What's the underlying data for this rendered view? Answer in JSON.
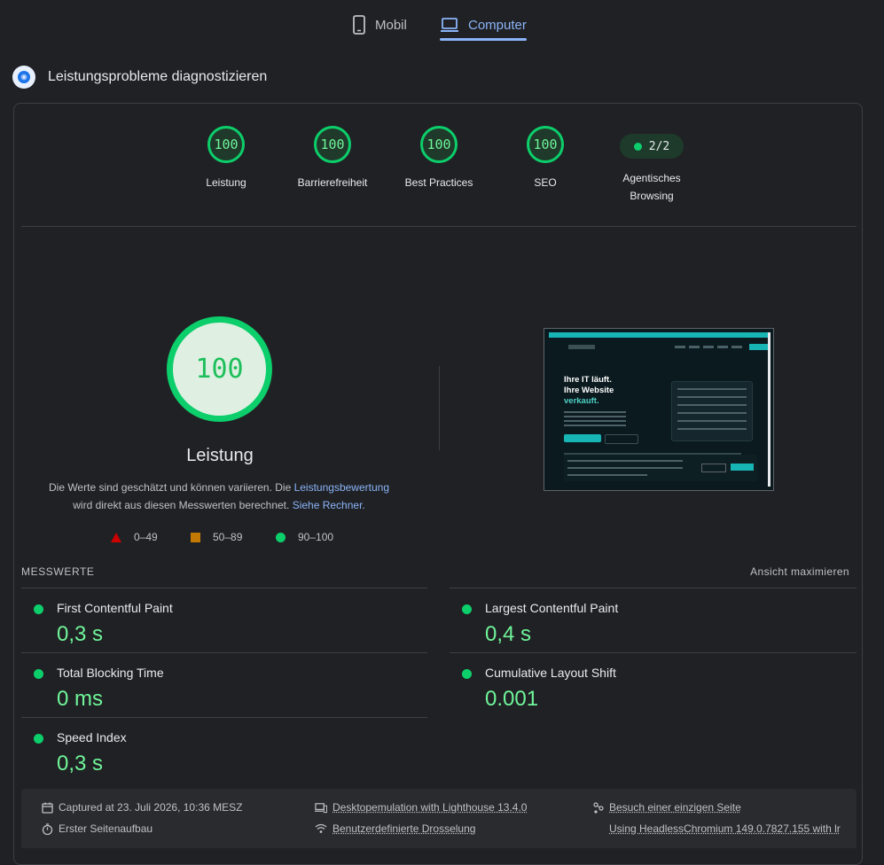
{
  "tabs": {
    "mobile": "Mobil",
    "desktop": "Computer"
  },
  "heading": "Leistungsprobleme diagnostizieren",
  "scores": [
    {
      "value": "100",
      "label": "Leistung"
    },
    {
      "value": "100",
      "label": "Barrierefreiheit"
    },
    {
      "value": "100",
      "label": "Best Practices"
    },
    {
      "value": "100",
      "label": "SEO"
    }
  ],
  "agentic": {
    "value": "2/2",
    "label_line1": "Agentisches",
    "label_line2": "Browsing"
  },
  "performance": {
    "score": "100",
    "title": "Leistung",
    "desc_1": "Die Werte sind geschätzt und können variieren. Die ",
    "desc_link_1": "Leistungsbewertung",
    "desc_2": "wird direkt aus diesen Messwerten berechnet. ",
    "desc_link_2": "Siehe Rechner."
  },
  "legend": {
    "poor": "0–49",
    "average": "50–89",
    "good": "90–100"
  },
  "colors": {
    "good": "#0cce6b",
    "average": "#c27a05",
    "poor": "#cc0000",
    "accent": "#8ab4f8"
  },
  "metrics": {
    "header": "MESSWERTE",
    "expand": "Ansicht maximieren",
    "fcp": {
      "name": "First Contentful Paint",
      "value": "0,3 s"
    },
    "lcp": {
      "name": "Largest Contentful Paint",
      "value": "0,4 s"
    },
    "tbt": {
      "name": "Total Blocking Time",
      "value": "0 ms"
    },
    "cls": {
      "name": "Cumulative Layout Shift",
      "value": "0.001"
    },
    "si": {
      "name": "Speed Index",
      "value": "0,3 s"
    }
  },
  "thumbnail": {
    "h_line1": "Ihre IT läuft.",
    "h_line2": "Ihre Website",
    "h_line3": "verkauft."
  },
  "footer": {
    "captured": "Captured at 23. Juli 2026, 10:36 MESZ",
    "first_load": "Erster Seitenaufbau",
    "emulation": "Desktopemulation with Lighthouse 13.4.0",
    "throttling": "Benutzerdefinierte Drosselung",
    "visit": "Besuch einer einzigen Seite",
    "browser": "Using HeadlessChromium 149.0.7827.155 with lr"
  }
}
